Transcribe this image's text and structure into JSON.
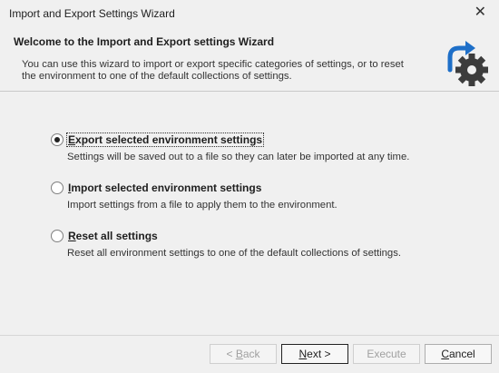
{
  "window": {
    "title": "Import and Export Settings Wizard",
    "close_glyph": "✕"
  },
  "header": {
    "title": "Welcome to the Import and Export settings Wizard",
    "description": "You can use this wizard to import or export specific categories of settings, or to reset the environment to one of the default collections of settings.",
    "logo_icon": "settings-sync-icon",
    "colors": {
      "arrow": "#1e6fc8",
      "gear": "#3c3c3c"
    }
  },
  "options": [
    {
      "mnemonic": "E",
      "label_rest": "xport selected environment settings",
      "description": "Settings will be saved out to a file so they can later be imported at any time.",
      "selected": true
    },
    {
      "mnemonic": "I",
      "label_rest": "mport selected environment settings",
      "description": "Import settings from a file to apply them to the environment.",
      "selected": false
    },
    {
      "mnemonic": "R",
      "label_rest": "eset all settings",
      "description": "Reset all environment settings to one of the default collections of settings.",
      "selected": false
    }
  ],
  "buttons": {
    "back": {
      "prefix": "< ",
      "mnemonic": "B",
      "rest": "ack",
      "enabled": false
    },
    "next": {
      "mnemonic": "N",
      "rest": "ext >",
      "enabled": true
    },
    "execute": {
      "label": "Execute",
      "enabled": false
    },
    "cancel": {
      "mnemonic": "C",
      "rest": "ancel",
      "enabled": true
    }
  }
}
